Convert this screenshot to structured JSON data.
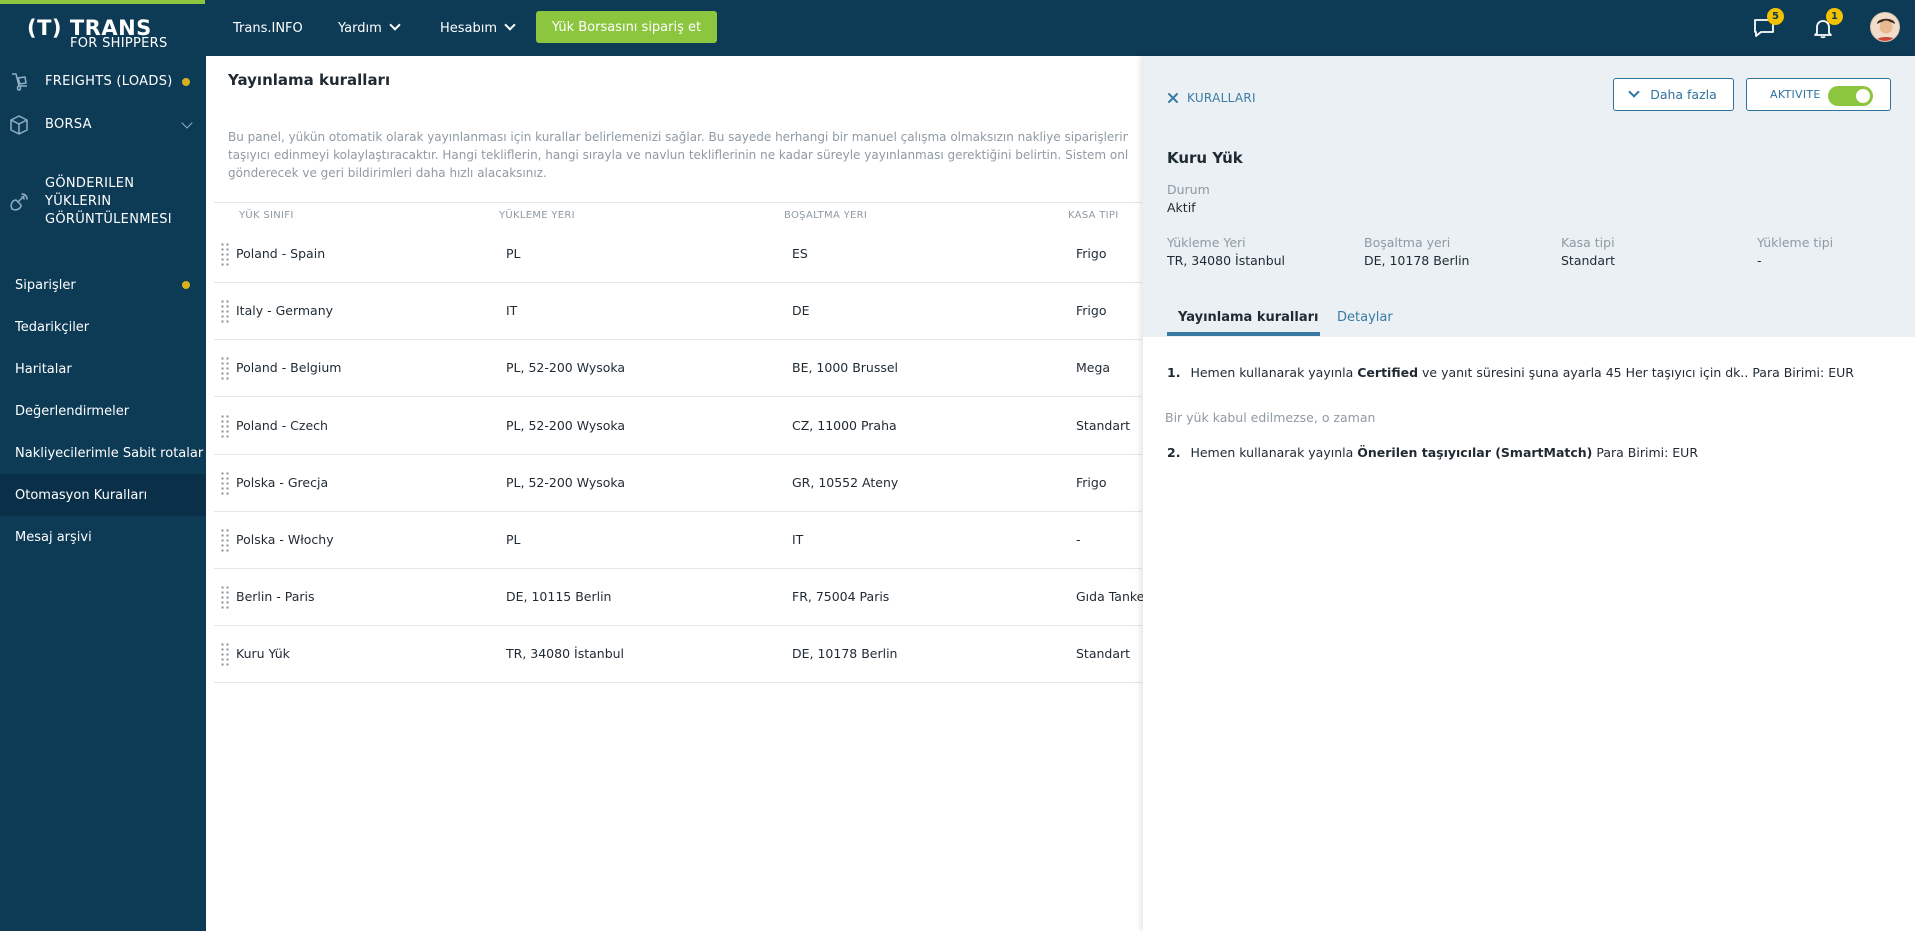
{
  "brand": {
    "logo_mark": "(T) TRANS",
    "logo_sub": "FOR SHIPPERS"
  },
  "topnav": {
    "items": [
      {
        "label": "Trans.INFO"
      },
      {
        "label": "Yardım"
      },
      {
        "label": "Hesabım"
      }
    ],
    "cta_label": "Yük Borsasını sipariş et",
    "messages_badge": "5",
    "notifications_badge": "1"
  },
  "sidebar": {
    "top_items": [
      {
        "label": "FREIGHTS (LOADS)",
        "icon": "dolly-icon"
      },
      {
        "label": "BORSA",
        "icon": "box-icon"
      },
      {
        "label_lines": [
          "GÖNDERILEN",
          "YÜKLERIN",
          "GÖRÜNTÜLENMESI"
        ],
        "icon": "satellite-icon"
      }
    ],
    "items": [
      {
        "label": "Siparişler"
      },
      {
        "label": "Tedarikçiler"
      },
      {
        "label": "Haritalar"
      },
      {
        "label": "Değerlendirmeler"
      },
      {
        "label": "Nakliyecilerimle Sabit rotalar"
      },
      {
        "label": "Otomasyon Kuralları"
      },
      {
        "label": "Mesaj arşivi"
      }
    ]
  },
  "main": {
    "title": "Yayınlama kuralları",
    "intro_lines": [
      "Bu panel, yükün otomatik olarak yayınlanması için kurallar belirlemenizi sağlar. Bu sayede herhangi bir manuel çalışma olmaksızın nakliye siparişlerinizi yürüt",
      "taşıyıcı edinmeyi kolaylaştıracaktır. Hangi tekliflerin, hangi sırayla ve navlun tekliflerinin ne kadar süreyle yayınlanması gerektiğini belirtin. Sistem onları seçile",
      "gönderecek ve geri bildirimleri daha hızlı alacaksınız."
    ],
    "table": {
      "columns": [
        "YÜK SINIFI",
        "YÜKLEME YERI",
        "BOŞALTMA YERI",
        "KASA TIPI"
      ],
      "rows": [
        {
          "name": "Poland - Spain",
          "loading": "PL",
          "unloading": "ES",
          "body": "Frigo"
        },
        {
          "name": "Italy - Germany",
          "loading": "IT",
          "unloading": "DE",
          "body": "Frigo"
        },
        {
          "name": "Poland - Belgium",
          "loading": "PL, 52-200 Wysoka",
          "unloading": "BE, 1000 Brussel",
          "body": "Mega"
        },
        {
          "name": "Poland - Czech",
          "loading": "PL, 52-200 Wysoka",
          "unloading": "CZ, 11000 Praha",
          "body": "Standart"
        },
        {
          "name": "Polska - Grecja",
          "loading": "PL, 52-200 Wysoka",
          "unloading": "GR, 10552 Ateny",
          "body": "Frigo"
        },
        {
          "name": "Polska - Włochy",
          "loading": "PL",
          "unloading": "IT",
          "body": "-"
        },
        {
          "name": "Berlin - Paris",
          "loading": "DE, 10115 Berlin",
          "unloading": "FR, 75004 Paris",
          "body": "Gıda Tankeri"
        },
        {
          "name": "Kuru Yük",
          "loading": "TR, 34080 İstanbul",
          "unloading": "DE, 10178 Berlin",
          "body": "Standart"
        }
      ]
    }
  },
  "panel": {
    "close_label": "KURALLARI",
    "more_label": "Daha fazla",
    "activate_label": "AKTIVITE",
    "title": "Kuru Yük",
    "status_label": "Durum",
    "status_value": "Aktif",
    "fields": [
      {
        "label": "Yükleme Yeri",
        "value": "TR, 34080 İstanbul"
      },
      {
        "label": "Boşaltma yeri",
        "value": "DE, 10178 Berlin"
      },
      {
        "label": "Kasa tipi",
        "value": "Standart"
      },
      {
        "label": "Yükleme tipi",
        "value": "-"
      }
    ],
    "tabs": [
      {
        "label": "Yayınlama kuralları"
      },
      {
        "label": "Detaylar"
      }
    ],
    "rules": [
      {
        "num": "1.",
        "pre": "Hemen kullanarak yayınla ",
        "bold": "Certified",
        "post": " ve yanıt süresini şuna ayarla 45 Her taşıyıcı için dk.. Para Birimi: EUR"
      },
      {
        "num": "2.",
        "pre": "Hemen kullanarak yayınla ",
        "bold": "Önerilen taşıyıcılar (SmartMatch)",
        "post": " Para Birimi: EUR"
      }
    ],
    "else_note": "Bir yük kabul edilmezse, o zaman"
  }
}
